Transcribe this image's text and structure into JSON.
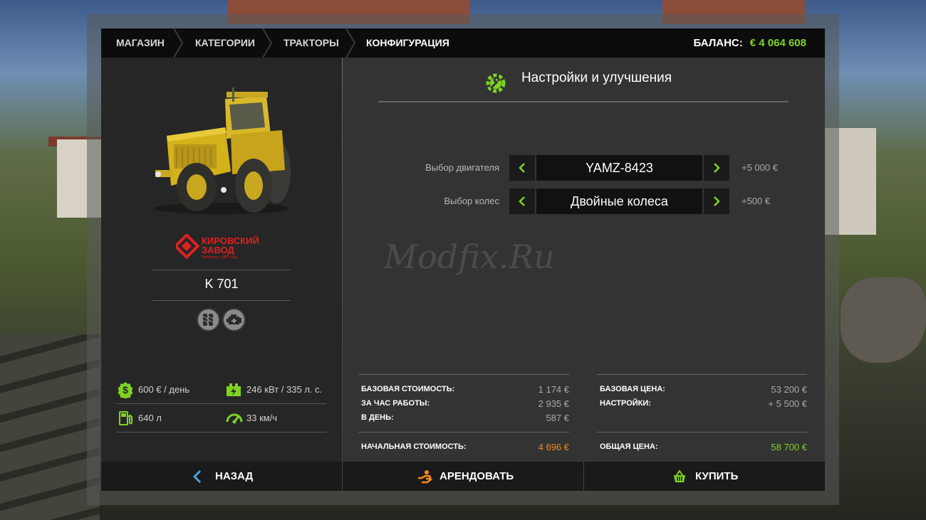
{
  "breadcrumbs": [
    {
      "label": "МАГАЗИН"
    },
    {
      "label": "КАТЕГОРИИ"
    },
    {
      "label": "ТРАКТОРЫ"
    },
    {
      "label": "КОНФИГУРАЦИЯ"
    }
  ],
  "balance": {
    "label": "БАЛАНС:",
    "value": "€ 4 064 608"
  },
  "vehicle": {
    "brand_logo": {
      "line1": "КИРОВСКИЙ",
      "line2": "ЗАВОД",
      "tagline": "Работаем с 1801 года"
    },
    "name": "K 701",
    "feature_icons": [
      "twin-wheels-icon",
      "engine-icon"
    ],
    "stats": [
      {
        "icon": "dollar-icon",
        "text": "600 € / день"
      },
      {
        "icon": "power-icon",
        "text": "246 кВт / 335 л. с."
      },
      {
        "icon": "fuel-icon",
        "text": "640 л"
      },
      {
        "icon": "speedometer-icon",
        "text": "33 км/ч"
      }
    ]
  },
  "config": {
    "title": "Настройки и улучшения",
    "options": [
      {
        "label": "Выбор двигателя",
        "value": "YAMZ-8423",
        "price": "+5 000 €"
      },
      {
        "label": "Выбор колес",
        "value": "Двойные колеса",
        "price": "+500 €"
      }
    ],
    "watermark": "Modfix.Ru"
  },
  "lease": {
    "base_cost": {
      "label": "БАЗОВАЯ СТОИМОСТЬ:",
      "value": "1 174 €"
    },
    "per_hour": {
      "label": "ЗА ЧАС РАБОТЫ:",
      "value": "2 935 €"
    },
    "per_day": {
      "label": "В ДЕНЬ:",
      "value": "587 €"
    },
    "initial": {
      "label": "НАЧАЛЬНАЯ СТОИМОСТЬ:",
      "value": "4 696 €"
    }
  },
  "purchase": {
    "base_price": {
      "label": "БАЗОВАЯ ЦЕНА:",
      "value": "53 200 €"
    },
    "settings": {
      "label": "НАСТРОЙКИ:",
      "value": "+ 5 500 €"
    },
    "total": {
      "label": "ОБЩАЯ ЦЕНА:",
      "value": "58 700 €"
    }
  },
  "buttons": {
    "back": "НАЗАД",
    "lease": "АРЕНДОВАТЬ",
    "buy": "КУПИТЬ"
  },
  "colors": {
    "accent_green": "#7ed321",
    "accent_orange": "#f58a1f",
    "logo_red": "#e02020",
    "back_arrow_blue": "#4aa3df"
  }
}
